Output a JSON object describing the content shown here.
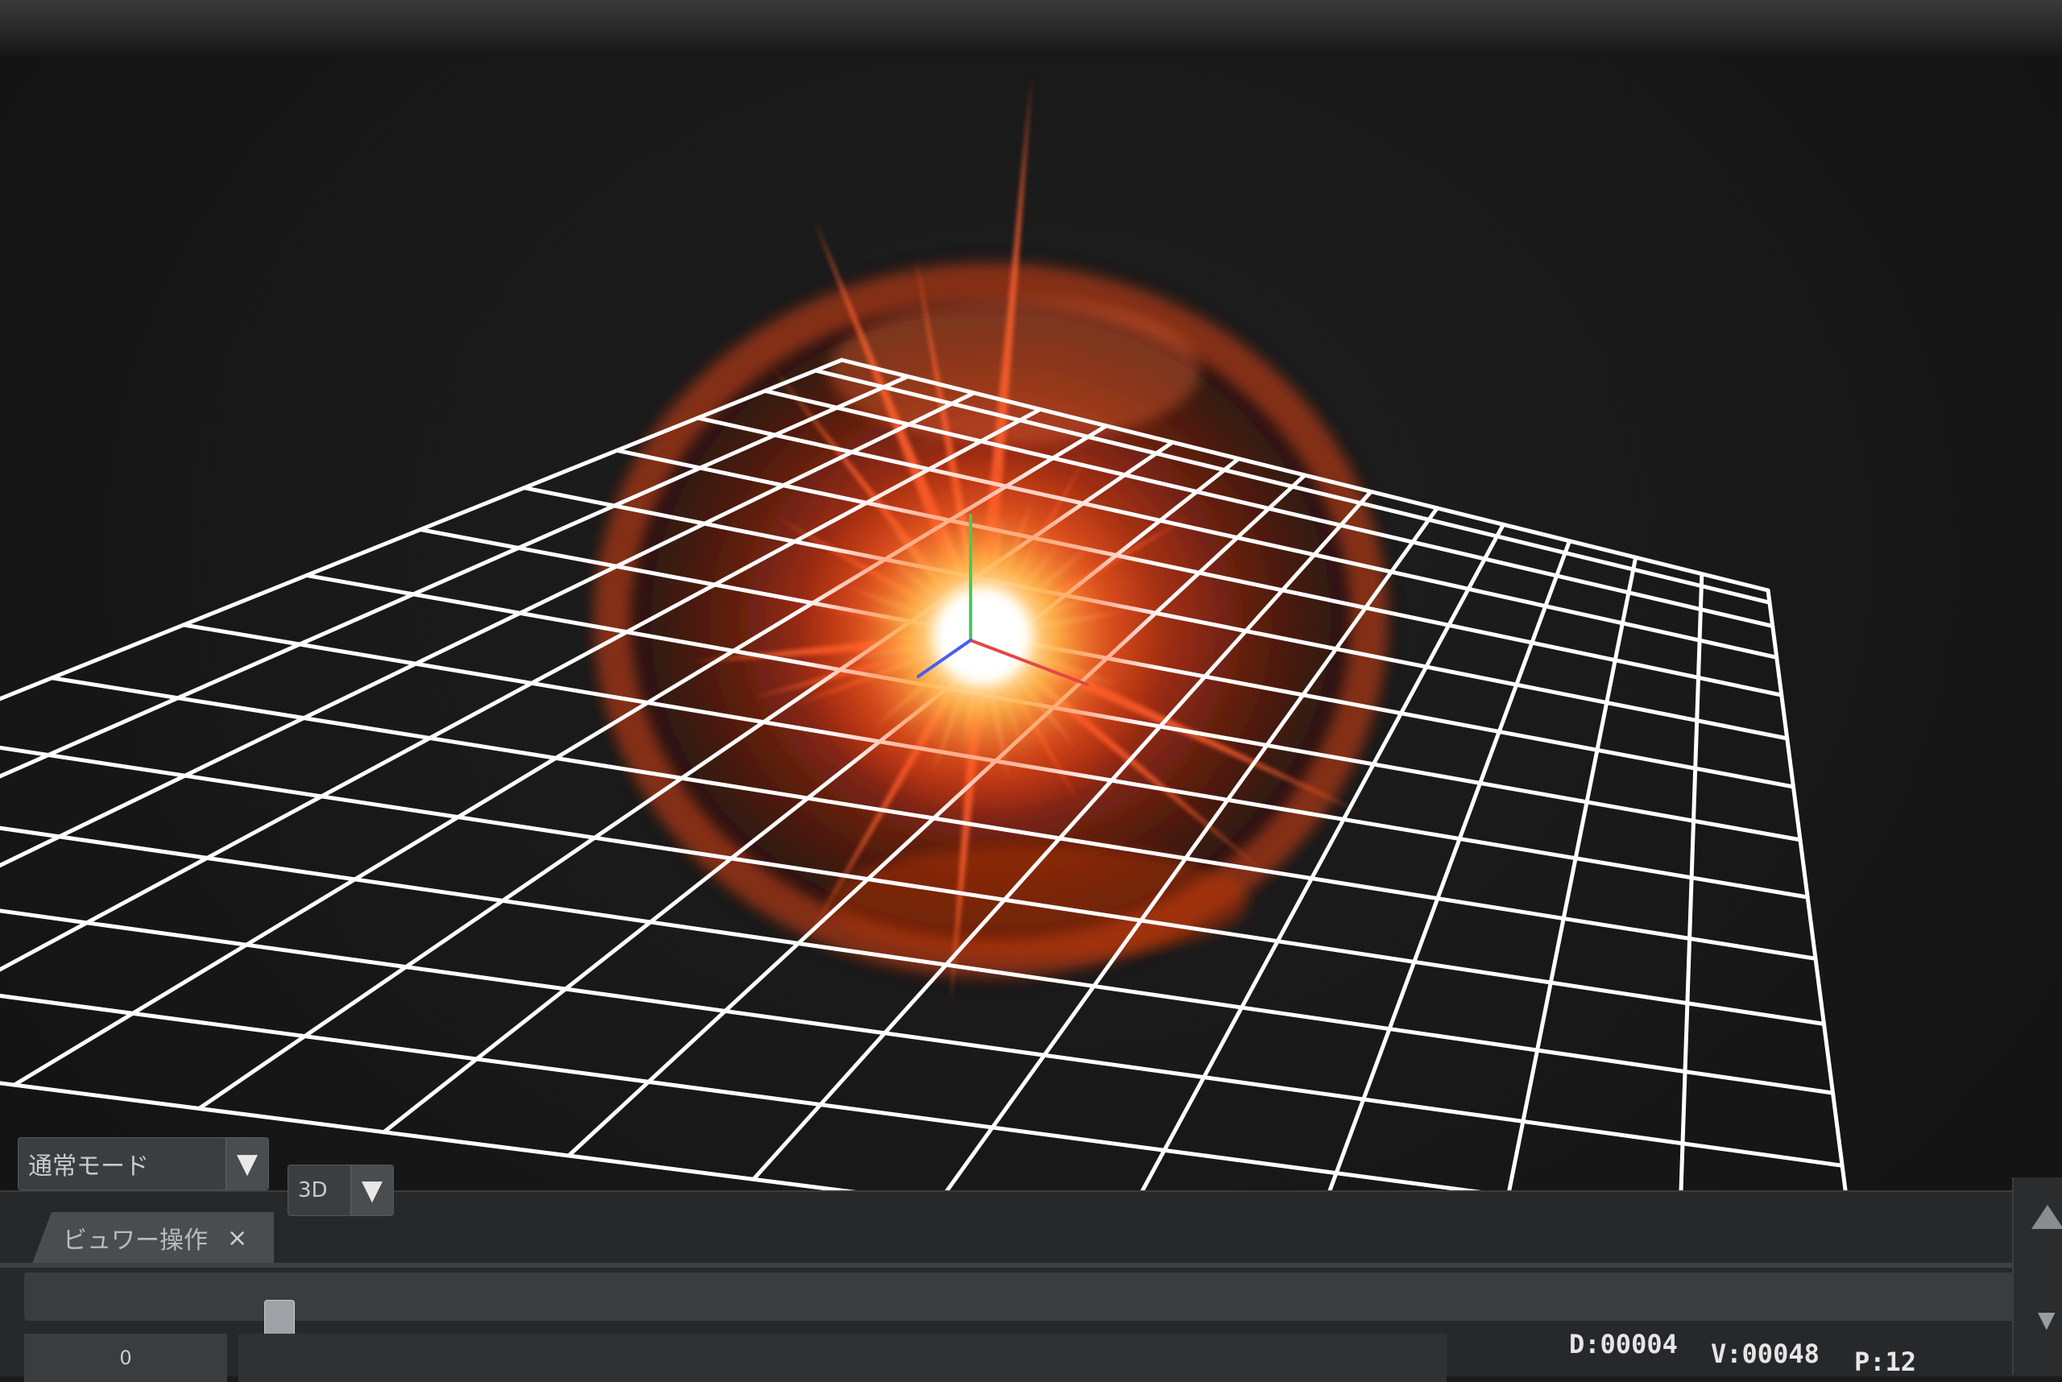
{
  "viewer": {
    "mode_label": "通常モード",
    "view_label": "3D",
    "dropdown_icon": "triangle-down-icon"
  },
  "tab": {
    "label": "ビュワー操作",
    "close_glyph": "×"
  },
  "timeline": {
    "frame_value": "0"
  },
  "stats": {
    "d": "D:00004",
    "v": "V:00048",
    "p": "P:12"
  },
  "colors": {
    "grid_line": "#ffffff",
    "effect_core": "#fff6d8",
    "effect_glow": "#ff5a1e",
    "effect_dark": "#8a1a08",
    "axis_x": "#e04848",
    "axis_y": "#3ecf5a",
    "axis_z": "#4a5cf0",
    "background": "#171717"
  }
}
